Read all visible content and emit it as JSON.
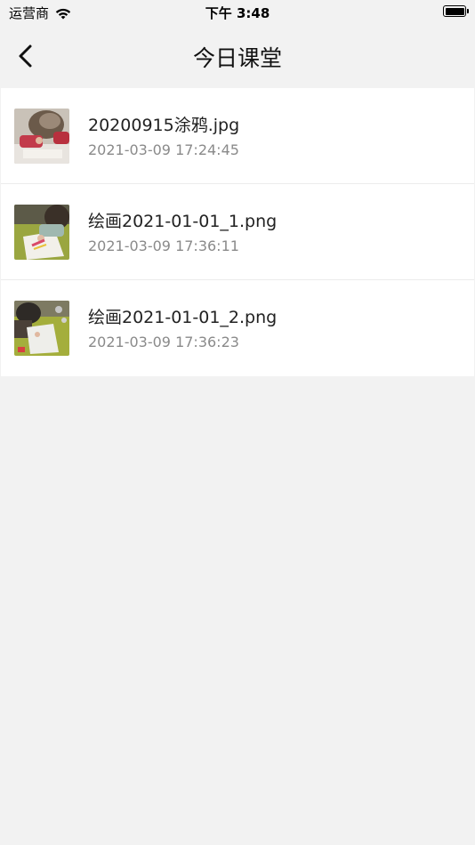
{
  "status_bar": {
    "carrier": "运营商",
    "time": "下午 3:48",
    "wifi_icon": "wifi-icon",
    "battery_icon": "battery-icon"
  },
  "nav": {
    "title": "今日课堂",
    "back_icon": "chevron-left-icon"
  },
  "files": [
    {
      "name": "20200915涂鸦.jpg",
      "date": "2021-03-09 17:24:45",
      "thumb_icon": "image-thumbnail-icon"
    },
    {
      "name": "绘画2021-01-01_1.png",
      "date": "2021-03-09 17:36:11",
      "thumb_icon": "image-thumbnail-icon"
    },
    {
      "name": "绘画2021-01-01_2.png",
      "date": "2021-03-09 17:36:23",
      "thumb_icon": "image-thumbnail-icon"
    }
  ],
  "colors": {
    "background": "#f2f2f2",
    "list_background": "#ffffff",
    "primary_text": "#222222",
    "secondary_text": "#8a8a8a"
  }
}
